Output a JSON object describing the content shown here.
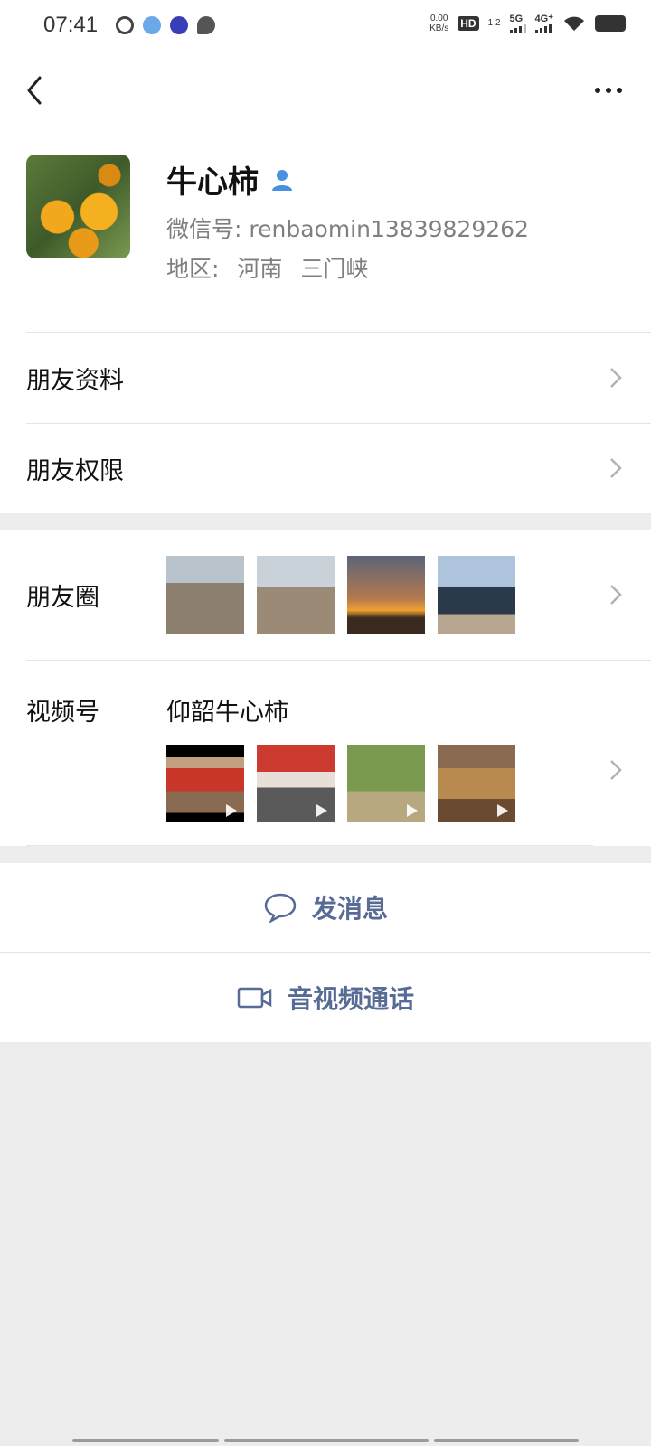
{
  "status_bar": {
    "time": "07:41",
    "net_speed_value": "0.00",
    "net_speed_unit": "KB/s",
    "hd_label": "HD",
    "sim_slots": "1 2",
    "sim1_label": "5G",
    "sim2_label": "4G⁺"
  },
  "profile": {
    "nickname": "牛心柿",
    "wechat_id_label": "微信号:",
    "wechat_id": "renbaomin13839829262",
    "region_label": "地区:",
    "province": "河南",
    "city": "三门峡"
  },
  "menu": {
    "friend_profile": "朋友资料",
    "friend_permissions": "朋友权限"
  },
  "moments": {
    "label": "朋友圈",
    "photos": [
      "orchard",
      "greenhouse-frames",
      "sunset",
      "gate"
    ]
  },
  "channels": {
    "label": "视频号",
    "name": "仰韶牛心柿",
    "videos": [
      "event-stage",
      "crowd-event",
      "man-in-orchard",
      "pottery-jars"
    ]
  },
  "actions": {
    "send_message": "发消息",
    "video_call": "音视频通话"
  },
  "colors": {
    "accent": "#576b95",
    "background": "#ededed",
    "contact_icon": "#4a90e2"
  },
  "icons": {
    "back": "chevron-left-icon",
    "more": "more-dots-icon",
    "contact": "contact-person-icon",
    "chevron": "chevron-right-icon",
    "message": "chat-bubble-icon",
    "video": "video-camera-icon"
  }
}
